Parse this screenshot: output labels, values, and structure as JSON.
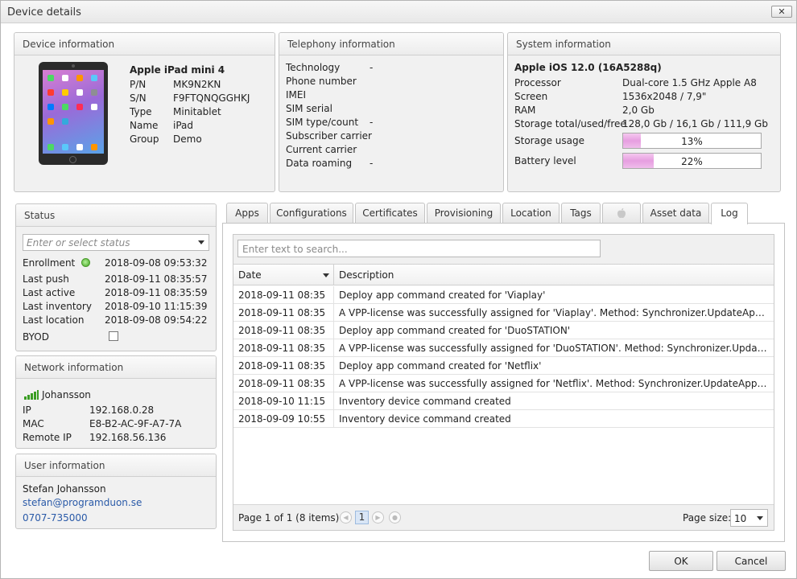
{
  "window": {
    "title": "Device details",
    "close_label": "✕"
  },
  "device_info": {
    "header": "Device information",
    "model": "Apple iPad mini 4",
    "rows": [
      {
        "label": "P/N",
        "value": "MK9N2KN"
      },
      {
        "label": "S/N",
        "value": "F9FTQNQGGHKJ"
      },
      {
        "label": "Type",
        "value": "Minitablet"
      },
      {
        "label": "Name",
        "value": "iPad"
      },
      {
        "label": "Group",
        "value": "Demo"
      }
    ],
    "image_icon": "ipad-device-icon"
  },
  "telephony": {
    "header": "Telephony information",
    "rows": [
      {
        "label": "Technology",
        "value": "-"
      },
      {
        "label": "Phone number",
        "value": ""
      },
      {
        "label": "IMEI",
        "value": ""
      },
      {
        "label": "SIM serial",
        "value": ""
      },
      {
        "label": "SIM type/count",
        "value": "-"
      },
      {
        "label": "Subscriber carrier",
        "value": ""
      },
      {
        "label": "Current carrier",
        "value": ""
      },
      {
        "label": "Data roaming",
        "value": "-"
      }
    ]
  },
  "system": {
    "header": "System information",
    "os": "Apple iOS 12.0 (16A5288q)",
    "rows": [
      {
        "label": "Processor",
        "value": "Dual-core 1.5 GHz Apple A8"
      },
      {
        "label": "Screen",
        "value": "1536x2048 / 7,9\""
      },
      {
        "label": "RAM",
        "value": "2,0 Gb"
      },
      {
        "label": "Storage total/used/free",
        "value": "128,0 Gb / 16,1 Gb / 111,9 Gb"
      }
    ],
    "storage_label": "Storage usage",
    "storage_text": "13%",
    "storage_fraction": 0.13,
    "battery_label": "Battery level",
    "battery_text": "22%",
    "battery_fraction": 0.22
  },
  "status": {
    "header": "Status",
    "select_placeholder": "Enter or select status",
    "enrollment_label": "Enrollment",
    "enrollment_value": "2018-09-08 09:53:32",
    "rows": [
      {
        "label": "Last push",
        "value": "2018-09-11 08:35:57"
      },
      {
        "label": "Last active",
        "value": "2018-09-11 08:35:59"
      },
      {
        "label": "Last inventory",
        "value": "2018-09-10 11:15:39"
      },
      {
        "label": "Last location",
        "value": "2018-09-08 09:54:22"
      }
    ],
    "byod_label": "BYOD",
    "byod_checked": false
  },
  "network": {
    "header": "Network information",
    "ssid": "Johansson",
    "rows": [
      {
        "label": "IP",
        "value": "192.168.0.28"
      },
      {
        "label": "MAC",
        "value": "E8-B2-AC-9F-A7-7A"
      },
      {
        "label": "Remote IP",
        "value": "192.168.56.136"
      }
    ]
  },
  "user": {
    "header": "User information",
    "name": "Stefan Johansson",
    "email": "stefan@programduon.se",
    "phone": "0707-735000"
  },
  "tabs": [
    {
      "label": "Apps"
    },
    {
      "label": "Configurations"
    },
    {
      "label": "Certificates"
    },
    {
      "label": "Provisioning"
    },
    {
      "label": "Location"
    },
    {
      "label": "Tags"
    },
    {
      "label": "",
      "icon": "apple-icon"
    },
    {
      "label": "Asset data"
    },
    {
      "label": "Log",
      "active": true
    }
  ],
  "log": {
    "search_placeholder": "Enter text to search...",
    "columns": [
      "Date",
      "Description"
    ],
    "rows": [
      {
        "date": "2018-09-11 08:35",
        "desc": "Deploy app command created for 'Viaplay'"
      },
      {
        "date": "2018-09-11 08:35",
        "desc": "A VPP-license was successfully assigned for 'Viaplay'. Method: Synchronizer.UpdateAppConfigu..."
      },
      {
        "date": "2018-09-11 08:35",
        "desc": "Deploy app command created for 'DuoSTATION'"
      },
      {
        "date": "2018-09-11 08:35",
        "desc": "A VPP-license was successfully assigned for 'DuoSTATION'. Method: Synchronizer.UpdateAppC..."
      },
      {
        "date": "2018-09-11 08:35",
        "desc": "Deploy app command created for 'Netflix'"
      },
      {
        "date": "2018-09-11 08:35",
        "desc": "A VPP-license was successfully assigned for 'Netflix'. Method: Synchronizer.UpdateAppConfigur..."
      },
      {
        "date": "2018-09-10 11:15",
        "desc": "Inventory device command created"
      },
      {
        "date": "2018-09-09 10:55",
        "desc": "Inventory device command created"
      }
    ],
    "pager_text": "Page 1 of 1 (8 items)",
    "current_page": "1",
    "page_size_label": "Page size:",
    "page_size": "10"
  },
  "buttons": {
    "ok": "OK",
    "cancel": "Cancel"
  }
}
